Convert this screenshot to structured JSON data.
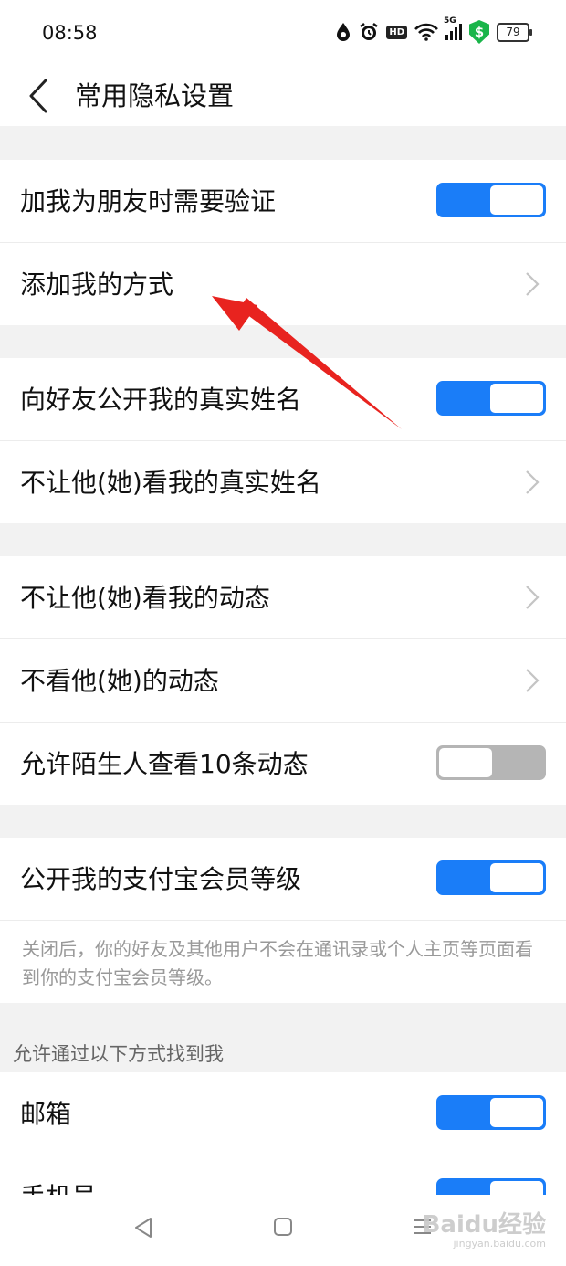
{
  "status": {
    "time": "08:58",
    "hd": "HD",
    "network": "5G",
    "shield": "$",
    "battery": "79"
  },
  "header": {
    "title": "常用隐私设置"
  },
  "groups": [
    {
      "rows": [
        {
          "label": "加我为朋友时需要验证",
          "type": "toggle",
          "on": true
        },
        {
          "label": "添加我的方式",
          "type": "chevron"
        }
      ]
    },
    {
      "rows": [
        {
          "label": "向好友公开我的真实姓名",
          "type": "toggle",
          "on": true
        },
        {
          "label": "不让他(她)看我的真实姓名",
          "type": "chevron"
        }
      ]
    },
    {
      "rows": [
        {
          "label": "不让他(她)看我的动态",
          "type": "chevron"
        },
        {
          "label": "不看他(她)的动态",
          "type": "chevron"
        },
        {
          "label": "允许陌生人查看10条动态",
          "type": "toggle",
          "on": false
        }
      ]
    },
    {
      "rows": [
        {
          "label": "公开我的支付宝会员等级",
          "type": "toggle",
          "on": true
        }
      ],
      "note": "关闭后，你的好友及其他用户不会在通讯录或个人主页等页面看到你的支付宝会员等级。"
    },
    {
      "rows": [
        {
          "label": "邮箱",
          "type": "toggle",
          "on": true
        },
        {
          "label": "手机号",
          "type": "toggle",
          "on": true
        }
      ]
    }
  ],
  "section_label": "允许通过以下方式找到我",
  "watermark": {
    "brand": "Baidu经验",
    "url": "jingyan.baidu.com"
  },
  "colors": {
    "accent": "#1a7df8",
    "off": "#b5b5b5",
    "annotation": "#e8231f"
  }
}
